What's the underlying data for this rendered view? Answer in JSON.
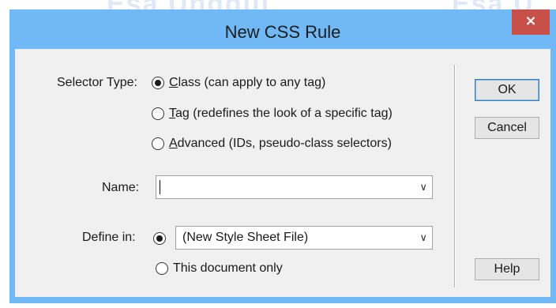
{
  "background_watermark": [
    "Esa Unggul",
    "Esa U"
  ],
  "window": {
    "title": "New CSS Rule",
    "close_glyph": "×"
  },
  "selector_type": {
    "label": "Selector Type:",
    "options": [
      {
        "accel": "C",
        "rest": "lass (can apply to any tag)",
        "checked": true
      },
      {
        "accel": "T",
        "rest": "ag (redefines the look of a specific tag)",
        "checked": false
      },
      {
        "accel": "A",
        "rest": "dvanced (IDs, pseudo-class selectors)",
        "checked": false
      }
    ]
  },
  "name": {
    "label": "Name:",
    "value": "",
    "arrow": "∨"
  },
  "define_in": {
    "label": "Define in:",
    "selected": "(New Style Sheet File)",
    "arrow": "∨",
    "option_document": "This document only",
    "new_file_checked": true,
    "document_only_checked": false
  },
  "buttons": {
    "ok": "OK",
    "cancel": "Cancel",
    "help": "Help"
  }
}
